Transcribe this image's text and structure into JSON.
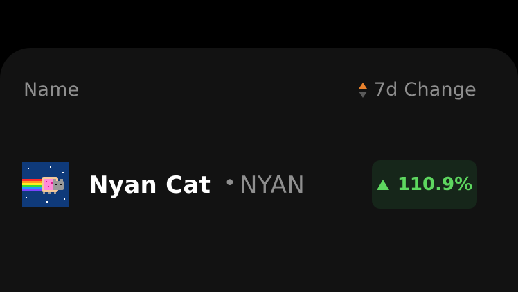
{
  "table": {
    "columns": {
      "name_label": "Name",
      "change_label": "7d Change"
    },
    "rows": [
      {
        "name": "Nyan Cat",
        "separator": "•",
        "symbol": "NYAN",
        "change": "110.9%",
        "change_direction": "up",
        "logo_icon": "nyan-cat-icon"
      }
    ]
  },
  "colors": {
    "background": "#000000",
    "card": "#121212",
    "muted_text": "#8f8f8f",
    "positive": "#5dd65f",
    "positive_bg": "#16261a",
    "sort_active": "#e8812c"
  }
}
